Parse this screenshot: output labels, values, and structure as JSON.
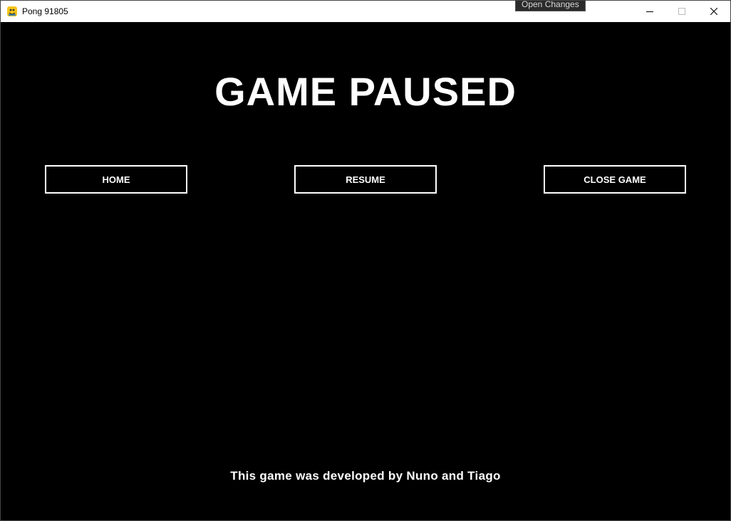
{
  "window": {
    "title": "Pong 91805",
    "app_icon": "pygame-snake-icon",
    "controls": {
      "minimize_icon": "minimize-icon",
      "maximize_icon": "maximize-icon",
      "close_icon": "close-icon"
    }
  },
  "tooltip": {
    "text": "Open Changes"
  },
  "game": {
    "background_color": "#000000",
    "text_color": "#ffffff",
    "heading": "GAME PAUSED",
    "buttons": [
      {
        "label": "HOME"
      },
      {
        "label": "RESUME"
      },
      {
        "label": "CLOSE GAME"
      }
    ],
    "credits": "This game was developed by Nuno and Tiago"
  }
}
